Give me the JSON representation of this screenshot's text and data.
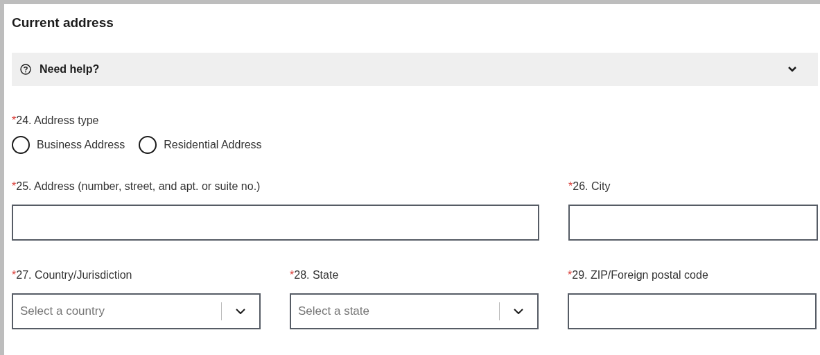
{
  "section_title": "Current address",
  "help": {
    "label": "Need help?",
    "expanded": false
  },
  "address_type": {
    "required_mark": "*",
    "label": "24. Address type",
    "options": [
      {
        "label": "Business Address",
        "selected": false
      },
      {
        "label": "Residential Address",
        "selected": false
      }
    ]
  },
  "rows": [
    [
      {
        "kind": "text",
        "required_mark": "*",
        "label": "25. Address (number, street, and apt. or suite no.)"
      },
      {
        "kind": "text",
        "required_mark": "*",
        "label": "26. City"
      }
    ],
    [
      {
        "kind": "select",
        "required_mark": "*",
        "label": "27. Country/Jurisdiction",
        "placeholder": "Select a country"
      },
      {
        "kind": "select",
        "required_mark": "*",
        "label": "28. State",
        "placeholder": "Select a state"
      },
      {
        "kind": "text",
        "required_mark": "*",
        "label": "29. ZIP/Foreign postal code"
      }
    ]
  ]
}
